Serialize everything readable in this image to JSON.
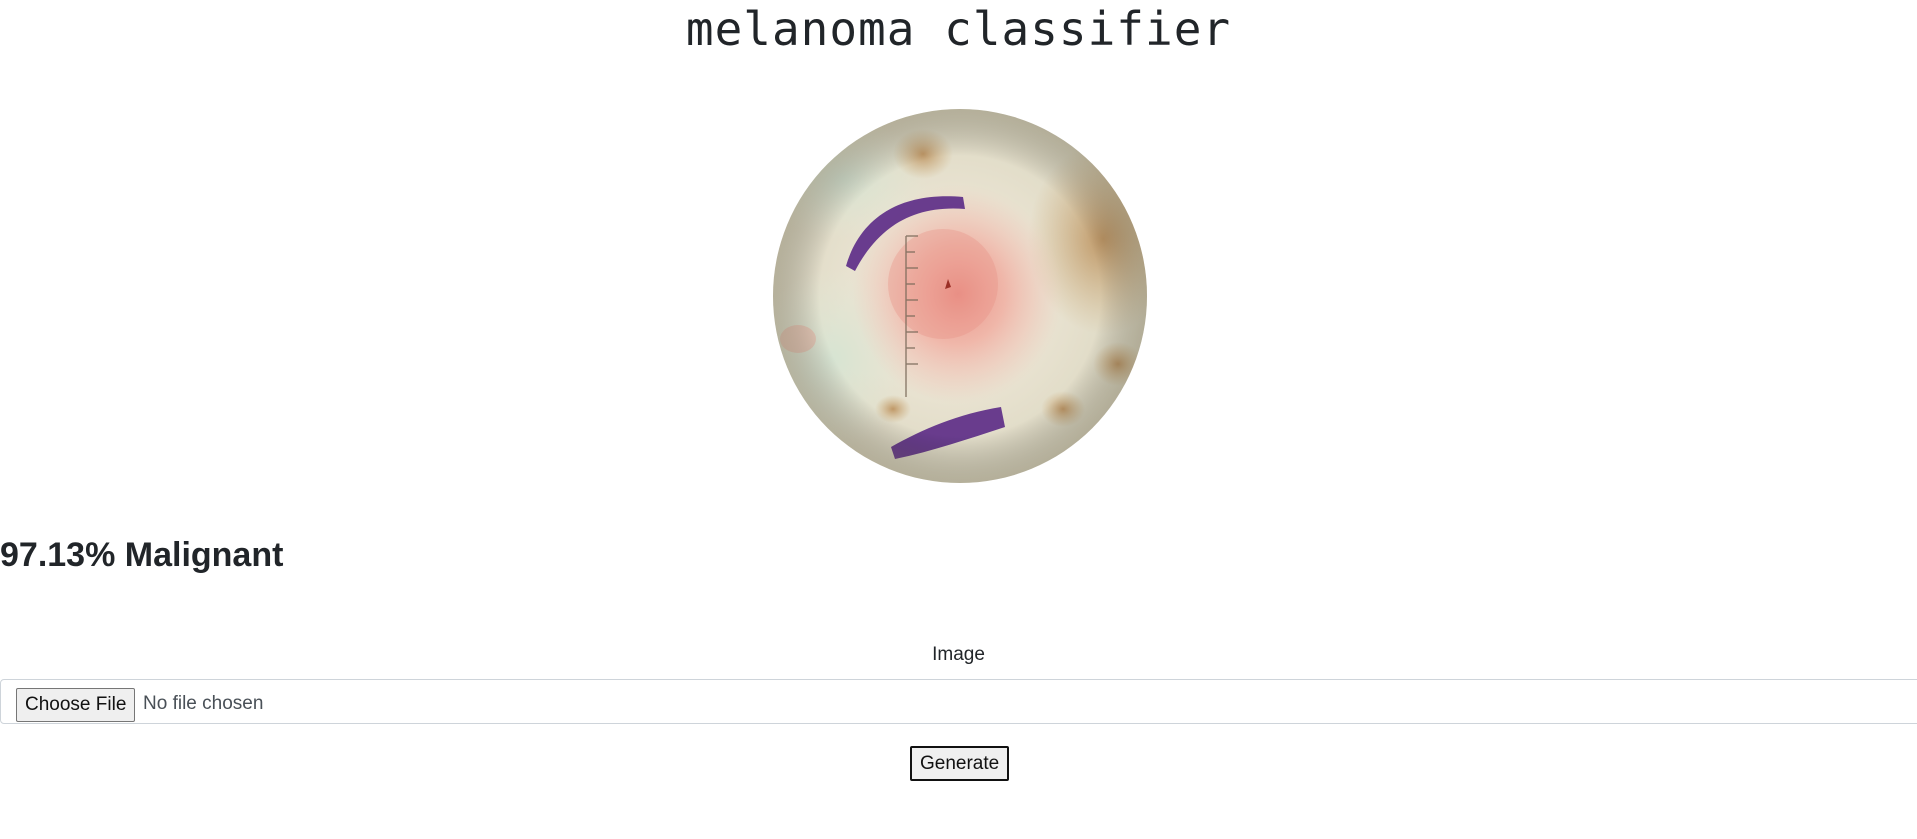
{
  "header": {
    "title": "melanoma classifier"
  },
  "preview": {
    "image_name": "dermoscopy-lesion-image"
  },
  "result": {
    "text": "97.13% Malignant"
  },
  "form": {
    "field_label": "Image",
    "choose_file_label": "Choose File",
    "file_status": "No file chosen",
    "generate_label": "Generate"
  },
  "colors": {
    "text": "#212529",
    "button_bg": "#efefef",
    "input_border": "#ced4da",
    "marker_ink": "#5b2a86",
    "lesion_pink": "#eea59a"
  }
}
